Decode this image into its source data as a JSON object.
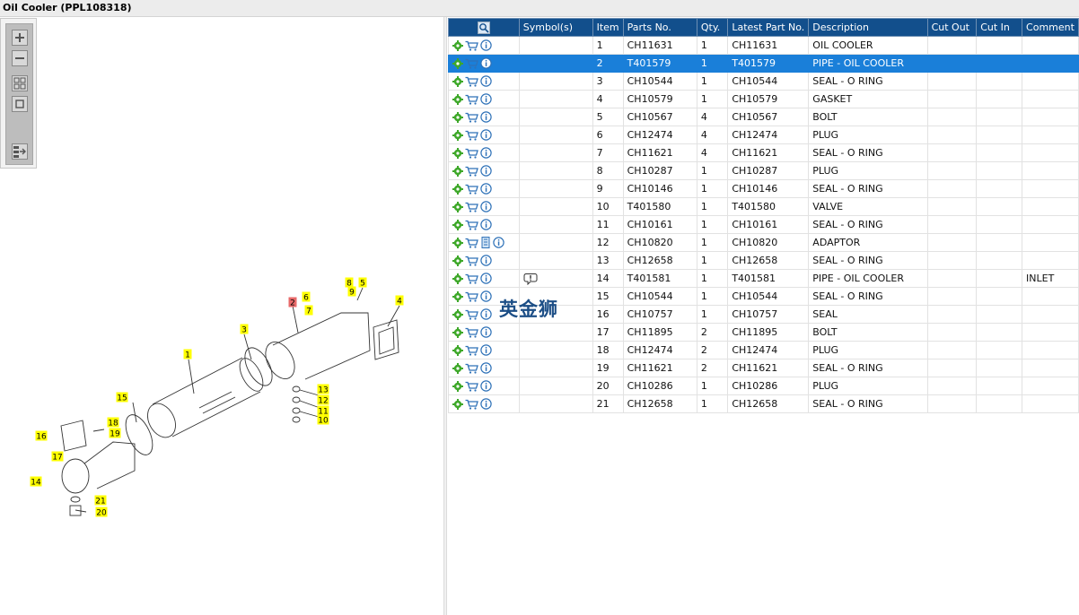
{
  "window": {
    "title": "Oil Cooler (PPL108318)"
  },
  "toolbar": {
    "buttons": [
      "zoom-in-icon",
      "zoom-out-icon",
      "fit-all-icon",
      "actual-size-icon",
      "export-list-icon"
    ]
  },
  "table": {
    "columns": [
      "",
      "Symbol(s)",
      "Item",
      "Parts No.",
      "Qty.",
      "Latest Part No.",
      "Description",
      "Cut Out",
      "Cut In",
      "Comment"
    ],
    "selected_item": "2",
    "rows": [
      {
        "item": "1",
        "part_no": "CH11631",
        "qty": "1",
        "latest": "CH11631",
        "desc": "OIL COOLER",
        "cut_out": "",
        "cut_in": "",
        "comment": ""
      },
      {
        "item": "2",
        "part_no": "T401579",
        "qty": "1",
        "latest": "T401579",
        "desc": "PIPE - OIL COOLER",
        "cut_out": "",
        "cut_in": "",
        "comment": ""
      },
      {
        "item": "3",
        "part_no": "CH10544",
        "qty": "1",
        "latest": "CH10544",
        "desc": "SEAL - O RING",
        "cut_out": "",
        "cut_in": "",
        "comment": ""
      },
      {
        "item": "4",
        "part_no": "CH10579",
        "qty": "1",
        "latest": "CH10579",
        "desc": "GASKET",
        "cut_out": "",
        "cut_in": "",
        "comment": ""
      },
      {
        "item": "5",
        "part_no": "CH10567",
        "qty": "4",
        "latest": "CH10567",
        "desc": "BOLT",
        "cut_out": "",
        "cut_in": "",
        "comment": ""
      },
      {
        "item": "6",
        "part_no": "CH12474",
        "qty": "4",
        "latest": "CH12474",
        "desc": "PLUG",
        "cut_out": "",
        "cut_in": "",
        "comment": ""
      },
      {
        "item": "7",
        "part_no": "CH11621",
        "qty": "4",
        "latest": "CH11621",
        "desc": "SEAL - O RING",
        "cut_out": "",
        "cut_in": "",
        "comment": ""
      },
      {
        "item": "8",
        "part_no": "CH10287",
        "qty": "1",
        "latest": "CH10287",
        "desc": "PLUG",
        "cut_out": "",
        "cut_in": "",
        "comment": ""
      },
      {
        "item": "9",
        "part_no": "CH10146",
        "qty": "1",
        "latest": "CH10146",
        "desc": "SEAL - O RING",
        "cut_out": "",
        "cut_in": "",
        "comment": ""
      },
      {
        "item": "10",
        "part_no": "T401580",
        "qty": "1",
        "latest": "T401580",
        "desc": "VALVE",
        "cut_out": "",
        "cut_in": "",
        "comment": ""
      },
      {
        "item": "11",
        "part_no": "CH10161",
        "qty": "1",
        "latest": "CH10161",
        "desc": "SEAL - O RING",
        "cut_out": "",
        "cut_in": "",
        "comment": ""
      },
      {
        "item": "12",
        "part_no": "CH10820",
        "qty": "1",
        "latest": "CH10820",
        "desc": "ADAPTOR",
        "cut_out": "",
        "cut_in": "",
        "comment": ""
      },
      {
        "item": "13",
        "part_no": "CH12658",
        "qty": "1",
        "latest": "CH12658",
        "desc": "SEAL - O RING",
        "cut_out": "",
        "cut_in": "",
        "comment": ""
      },
      {
        "item": "14",
        "part_no": "T401581",
        "qty": "1",
        "latest": "T401581",
        "desc": "PIPE - OIL COOLER",
        "cut_out": "",
        "cut_in": "",
        "comment": "INLET"
      },
      {
        "item": "15",
        "part_no": "CH10544",
        "qty": "1",
        "latest": "CH10544",
        "desc": "SEAL - O RING",
        "cut_out": "",
        "cut_in": "",
        "comment": ""
      },
      {
        "item": "16",
        "part_no": "CH10757",
        "qty": "1",
        "latest": "CH10757",
        "desc": "SEAL",
        "cut_out": "",
        "cut_in": "",
        "comment": ""
      },
      {
        "item": "17",
        "part_no": "CH11895",
        "qty": "2",
        "latest": "CH11895",
        "desc": "BOLT",
        "cut_out": "",
        "cut_in": "",
        "comment": ""
      },
      {
        "item": "18",
        "part_no": "CH12474",
        "qty": "2",
        "latest": "CH12474",
        "desc": "PLUG",
        "cut_out": "",
        "cut_in": "",
        "comment": ""
      },
      {
        "item": "19",
        "part_no": "CH11621",
        "qty": "2",
        "latest": "CH11621",
        "desc": "SEAL - O RING",
        "cut_out": "",
        "cut_in": "",
        "comment": ""
      },
      {
        "item": "20",
        "part_no": "CH10286",
        "qty": "1",
        "latest": "CH10286",
        "desc": "PLUG",
        "cut_out": "",
        "cut_in": "",
        "comment": ""
      },
      {
        "item": "21",
        "part_no": "CH12658",
        "qty": "1",
        "latest": "CH12658",
        "desc": "SEAL - O RING",
        "cut_out": "",
        "cut_in": "",
        "comment": ""
      }
    ]
  },
  "diagram": {
    "callouts": [
      "1",
      "2",
      "3",
      "4",
      "5",
      "6",
      "7",
      "8",
      "9",
      "10",
      "11",
      "12",
      "13",
      "14",
      "15",
      "16",
      "17",
      "18",
      "19",
      "20",
      "21"
    ],
    "highlighted_callout": "2"
  },
  "watermark": {
    "text": "英金狮"
  },
  "colors": {
    "header_bg": "#124f8c",
    "selected_row": "#1a7fd9",
    "callout": "#ffff00",
    "callout_selected": "#e86a6a",
    "gear_icon": "#3ea829",
    "cart_icon": "#2f72b8",
    "info_icon": "#2f72b8"
  }
}
